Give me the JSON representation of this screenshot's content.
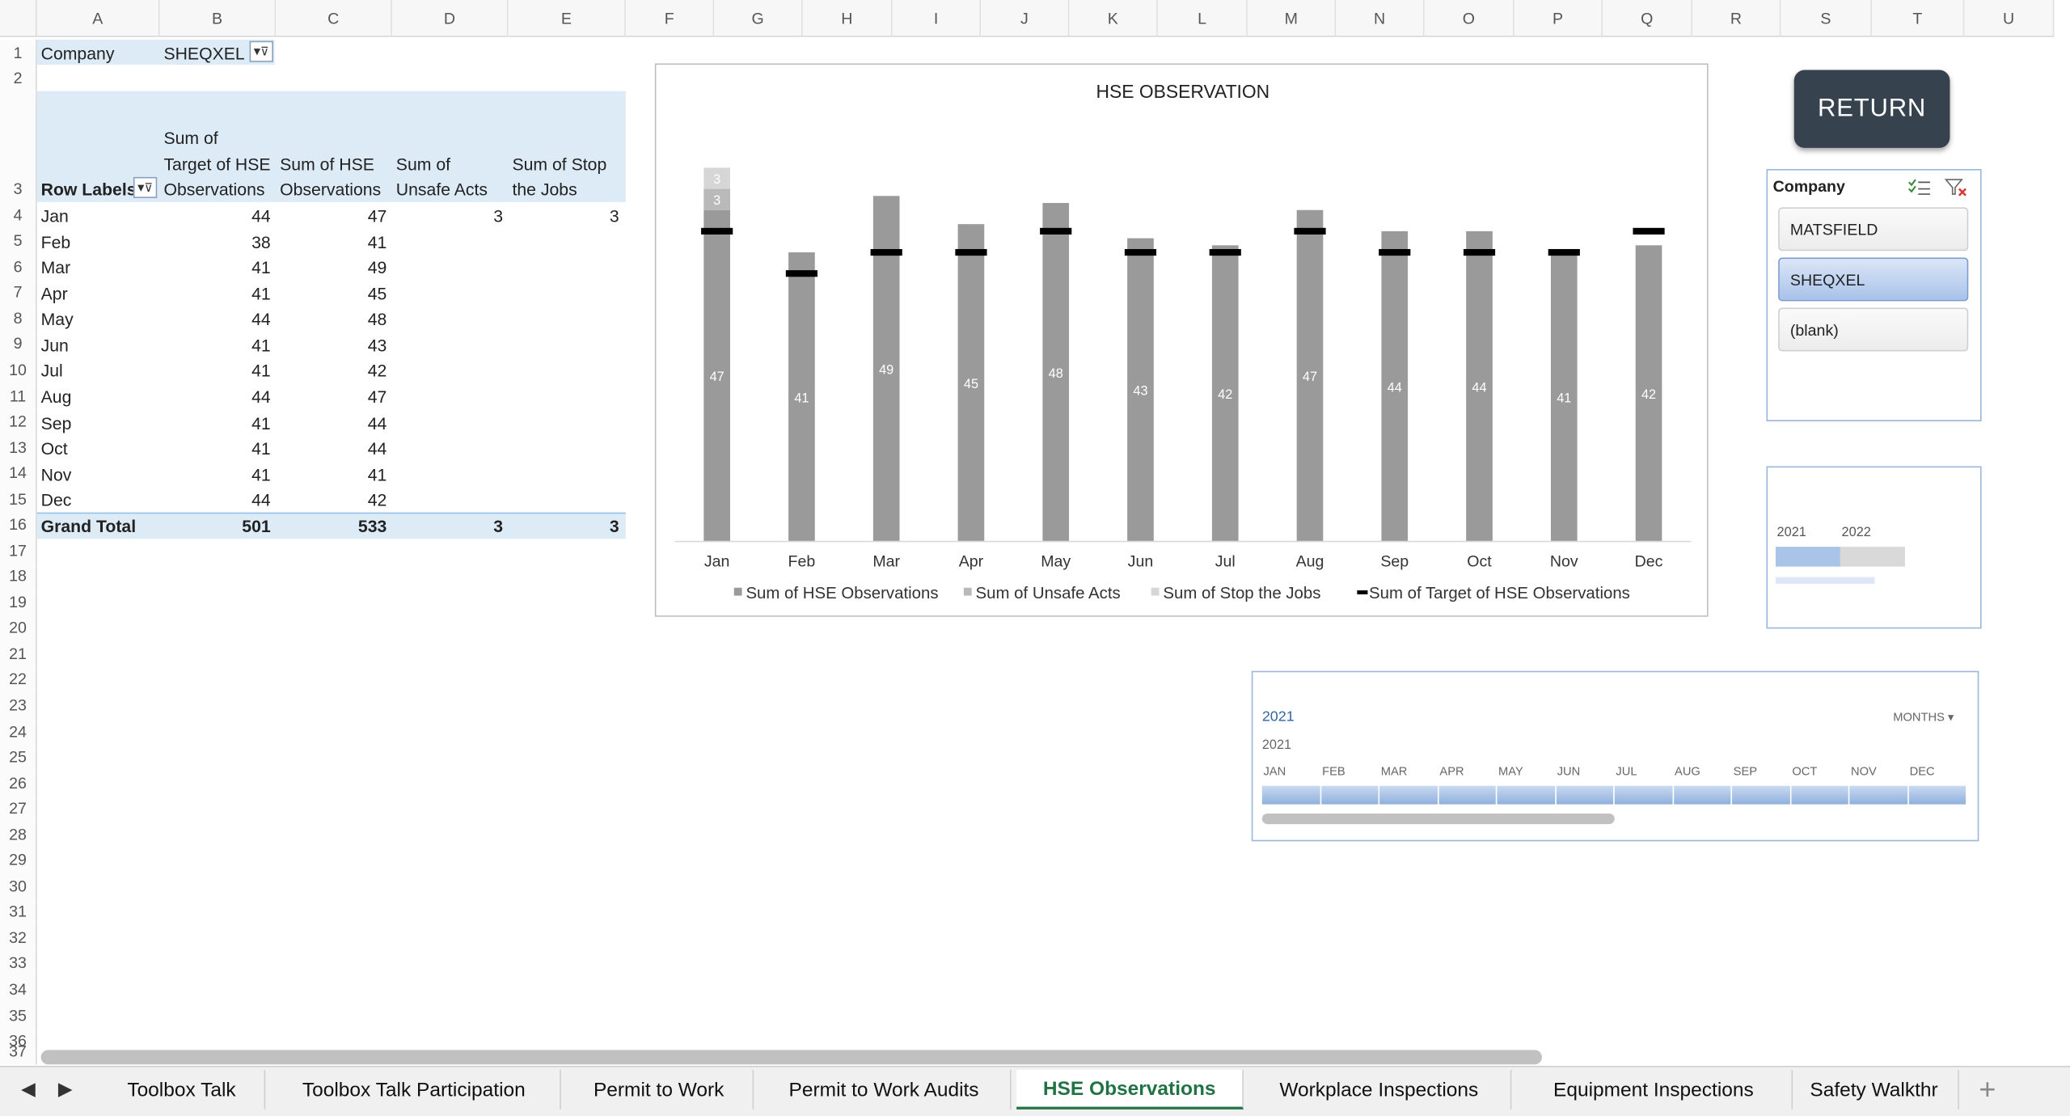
{
  "columns": [
    "A",
    "B",
    "C",
    "D",
    "E",
    "F",
    "G",
    "H",
    "I",
    "J",
    "K",
    "L",
    "M",
    "N",
    "O",
    "P",
    "Q",
    "R",
    "S",
    "T",
    "U"
  ],
  "rows": [
    "1",
    "2",
    "3",
    "4",
    "5",
    "6",
    "7",
    "8",
    "9",
    "10",
    "11",
    "12",
    "13",
    "14",
    "15",
    "16",
    "17",
    "18",
    "19",
    "20",
    "21",
    "22",
    "23",
    "24",
    "25",
    "26",
    "27",
    "28",
    "29",
    "30",
    "31",
    "32",
    "33",
    "34",
    "35",
    "36",
    "37"
  ],
  "filter": {
    "label": "Company",
    "value": "SHEQXEL"
  },
  "pivot": {
    "row_labels_header": "Row Labels",
    "col_headers": [
      [
        "Sum of",
        "Target of HSE",
        "Observations"
      ],
      [
        "Sum of HSE",
        "Observations"
      ],
      [
        "Sum of",
        "Unsafe Acts"
      ],
      [
        "Sum of Stop",
        "the Jobs"
      ]
    ],
    "rows": [
      {
        "label": "Jan",
        "target": "44",
        "obs": "47",
        "unsafe": "3",
        "stop": "3"
      },
      {
        "label": "Feb",
        "target": "38",
        "obs": "41",
        "unsafe": "",
        "stop": ""
      },
      {
        "label": "Mar",
        "target": "41",
        "obs": "49",
        "unsafe": "",
        "stop": ""
      },
      {
        "label": "Apr",
        "target": "41",
        "obs": "45",
        "unsafe": "",
        "stop": ""
      },
      {
        "label": "May",
        "target": "44",
        "obs": "48",
        "unsafe": "",
        "stop": ""
      },
      {
        "label": "Jun",
        "target": "41",
        "obs": "43",
        "unsafe": "",
        "stop": ""
      },
      {
        "label": "Jul",
        "target": "41",
        "obs": "42",
        "unsafe": "",
        "stop": ""
      },
      {
        "label": "Aug",
        "target": "44",
        "obs": "47",
        "unsafe": "",
        "stop": ""
      },
      {
        "label": "Sep",
        "target": "41",
        "obs": "44",
        "unsafe": "",
        "stop": ""
      },
      {
        "label": "Oct",
        "target": "41",
        "obs": "44",
        "unsafe": "",
        "stop": ""
      },
      {
        "label": "Nov",
        "target": "41",
        "obs": "41",
        "unsafe": "",
        "stop": ""
      },
      {
        "label": "Dec",
        "target": "44",
        "obs": "42",
        "unsafe": "",
        "stop": ""
      }
    ],
    "total": {
      "label": "Grand Total",
      "target": "501",
      "obs": "533",
      "unsafe": "3",
      "stop": "3"
    }
  },
  "chart_data": {
    "type": "bar",
    "title": "HSE OBSERVATION",
    "stacked": true,
    "categories": [
      "Jan",
      "Feb",
      "Mar",
      "Apr",
      "May",
      "Jun",
      "Jul",
      "Aug",
      "Sep",
      "Oct",
      "Nov",
      "Dec"
    ],
    "series": [
      {
        "name": "Sum of HSE Observations",
        "values": [
          47,
          41,
          49,
          45,
          48,
          43,
          42,
          47,
          44,
          44,
          41,
          42
        ],
        "color": "#9a9a9a"
      },
      {
        "name": "Sum of Unsafe Acts",
        "values": [
          3,
          0,
          0,
          0,
          0,
          0,
          0,
          0,
          0,
          0,
          0,
          0
        ],
        "color": "#b9b9b9"
      },
      {
        "name": "Sum of Stop  the Jobs",
        "values": [
          3,
          0,
          0,
          0,
          0,
          0,
          0,
          0,
          0,
          0,
          0,
          0
        ],
        "color": "#d6d6d6"
      },
      {
        "name": "Sum of Target of HSE Observations",
        "values": [
          44,
          38,
          41,
          41,
          44,
          41,
          41,
          44,
          41,
          41,
          41,
          44
        ],
        "color": "#000000",
        "marker": "dash"
      }
    ],
    "ylim": [
      0,
      53
    ],
    "grid": false,
    "legend": "bottom"
  },
  "return_label": "RETURN",
  "slicer": {
    "title": "Company",
    "items": [
      {
        "label": "MATSFIELD",
        "selected": false
      },
      {
        "label": "SHEQXEL",
        "selected": true
      },
      {
        "label": "(blank)",
        "selected": false
      }
    ]
  },
  "year_slicer": {
    "years": [
      "2021",
      "2022"
    ],
    "selected": "2021"
  },
  "timeline": {
    "year_title": "2021",
    "level": "MONTHS",
    "year_row": "2021",
    "months": [
      "JAN",
      "FEB",
      "MAR",
      "APR",
      "MAY",
      "JUN",
      "JUL",
      "AUG",
      "SEP",
      "OCT",
      "NOV",
      "DEC"
    ]
  },
  "tabs": [
    {
      "label": "Toolbox Talk",
      "active": false
    },
    {
      "label": "Toolbox Talk Participation",
      "active": false
    },
    {
      "label": "Permit to Work",
      "active": false
    },
    {
      "label": "Permit to Work Audits",
      "active": false
    },
    {
      "label": "HSE Observations",
      "active": true
    },
    {
      "label": "Workplace Inspections",
      "active": false
    },
    {
      "label": "Equipment Inspections",
      "active": false
    },
    {
      "label": "Safety Walkthr",
      "active": false
    }
  ],
  "colors": {
    "accent": "#217346",
    "pivot_band": "#ddebf7",
    "return_bg": "#36434f",
    "timeline_bar": "#a9c4e8"
  }
}
